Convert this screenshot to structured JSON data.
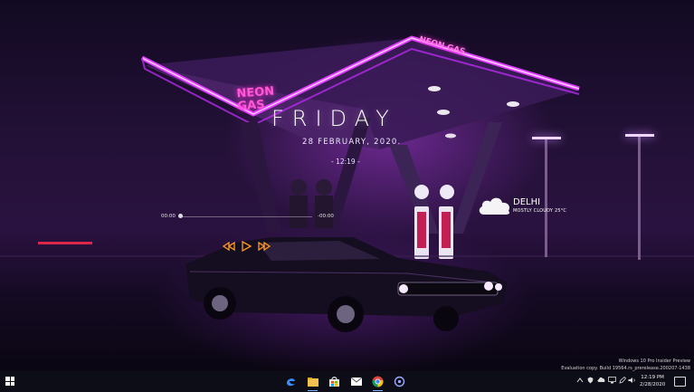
{
  "desktop": {
    "clock_widget": {
      "day": "FRIDAY",
      "date": "28 FEBRUARY, 2020.",
      "time": "- 12:19 -"
    },
    "media_player": {
      "elapsed": "00:00",
      "remaining": "-00:00",
      "progress": 0
    },
    "weather_widget": {
      "city": "DELHI",
      "condition": "MOSTLY CLOUDY 25°C"
    },
    "wallpaper_sign": {
      "left": "NEON GAS",
      "right": "NEON GAS"
    },
    "watermark": {
      "line1": "Windows 10 Pro Insider Preview",
      "line2": "Evaluation copy. Build 19564.rs_prerelease.200207-1438"
    }
  },
  "taskbar": {
    "pinned": [
      {
        "name": "edge-icon"
      },
      {
        "name": "file-explorer-icon"
      },
      {
        "name": "store-icon"
      },
      {
        "name": "mail-icon"
      },
      {
        "name": "chrome-icon"
      },
      {
        "name": "photos-icon"
      }
    ],
    "tray": {
      "time": "12:19 PM",
      "date": "2/28/2020"
    }
  },
  "colors": {
    "neon_magenta": "#e23cff",
    "neon_purple": "#9a43ff",
    "media_accent": "#ff9a1f",
    "taskbar_bg": "#0d0d18"
  }
}
